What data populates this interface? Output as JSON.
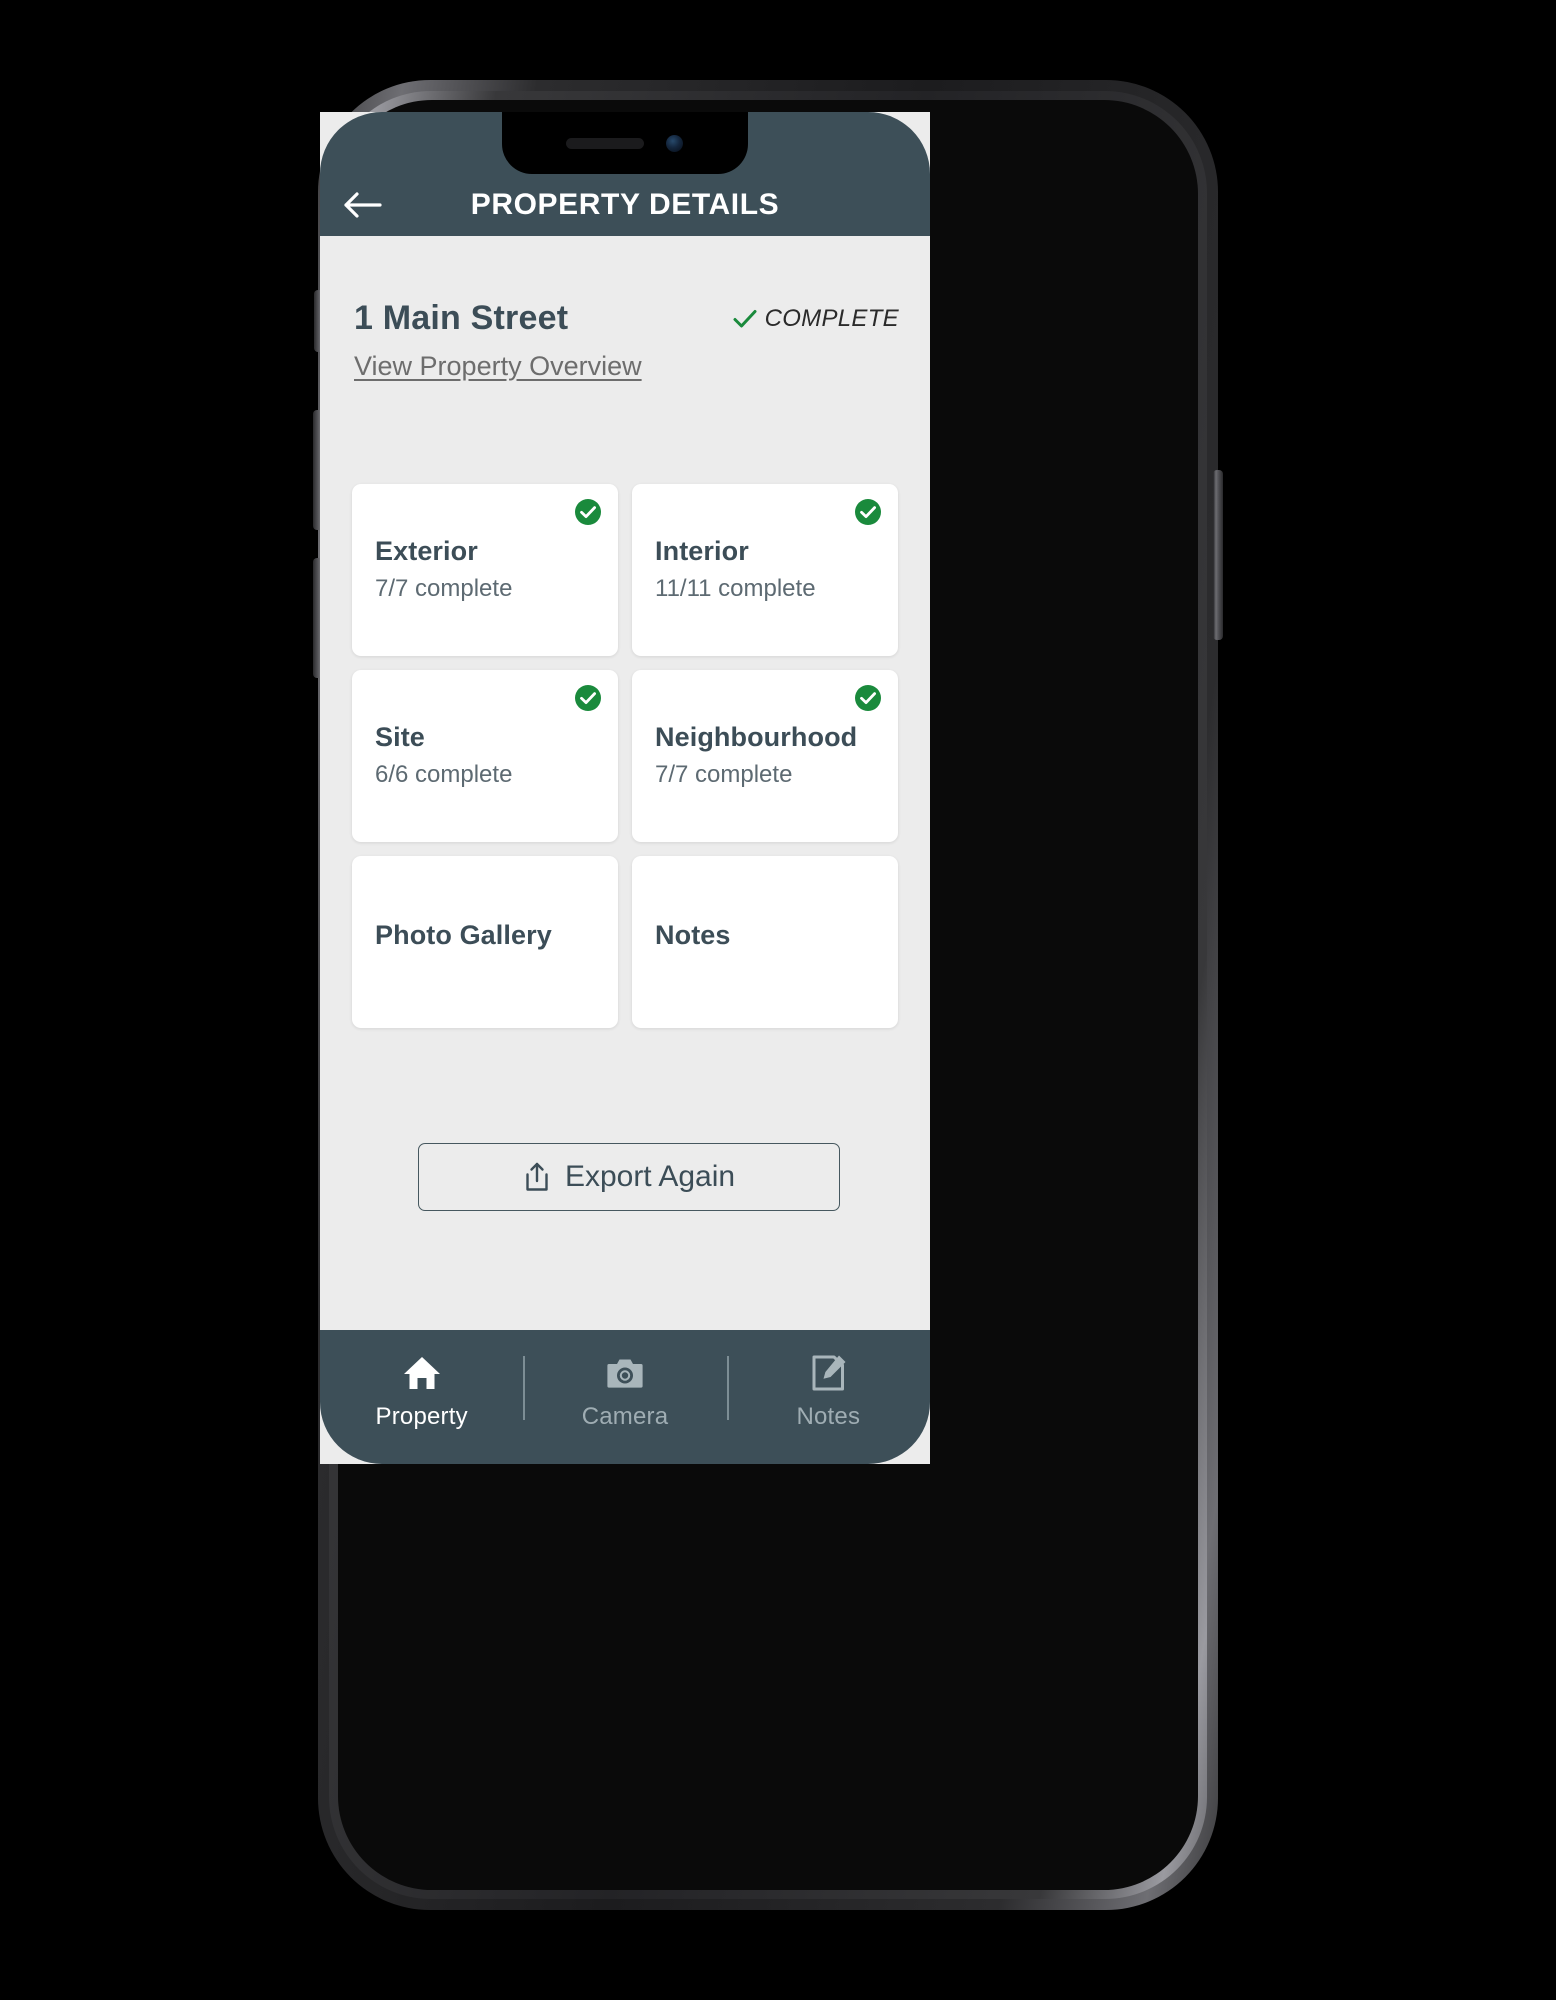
{
  "app": {
    "header": {
      "title": "PROPERTY DETAILS",
      "back_icon": "arrow-left-icon",
      "background_color": "#3d4f58"
    },
    "property": {
      "address": "1 Main Street",
      "status_label": "COMPLETE",
      "status_icon": "check-icon",
      "status_color": "#1a8a3c",
      "overview_link": "View Property Overview"
    },
    "sections": [
      {
        "title": "Exterior",
        "subtitle": "7/7 complete",
        "complete": true,
        "badge_icon": "check-circle-icon"
      },
      {
        "title": "Interior",
        "subtitle": "11/11 complete",
        "complete": true,
        "badge_icon": "check-circle-icon"
      },
      {
        "title": "Site",
        "subtitle": "6/6 complete",
        "complete": true,
        "badge_icon": "check-circle-icon"
      },
      {
        "title": "Neighbourhood",
        "subtitle": "7/7 complete",
        "complete": true,
        "badge_icon": "check-circle-icon"
      },
      {
        "title": "Photo Gallery",
        "subtitle": "",
        "complete": false,
        "badge_icon": ""
      },
      {
        "title": "Notes",
        "subtitle": "",
        "complete": false,
        "badge_icon": ""
      }
    ],
    "export": {
      "label": "Export Again",
      "icon": "share-upload-icon"
    },
    "tabbar": {
      "items": [
        {
          "label": "Property",
          "icon": "home-icon",
          "active": true
        },
        {
          "label": "Camera",
          "icon": "camera-icon",
          "active": false
        },
        {
          "label": "Notes",
          "icon": "note-edit-icon",
          "active": false
        }
      ]
    },
    "colors": {
      "accent_dark": "#3d4f58",
      "screen_bg": "#ececec",
      "card_bg": "#ffffff",
      "success_green": "#1a8a3c",
      "text_primary": "#3c4d57",
      "text_muted": "#6d6d6d"
    }
  }
}
